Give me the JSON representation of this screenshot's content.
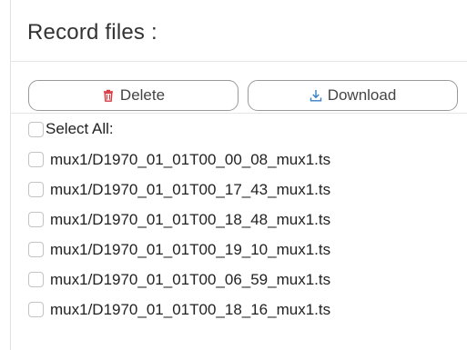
{
  "header": {
    "title": "Record files :"
  },
  "toolbar": {
    "delete_label": "Delete",
    "download_label": "Download",
    "delete_icon": "trash-icon",
    "download_icon": "download-icon",
    "delete_color": "#d9363e",
    "download_color": "#3a7fc4"
  },
  "list": {
    "select_all_label": "Select All:",
    "files": [
      "mux1/D1970_01_01T00_00_08_mux1.ts",
      "mux1/D1970_01_01T00_17_43_mux1.ts",
      "mux1/D1970_01_01T00_18_48_mux1.ts",
      "mux1/D1970_01_01T00_19_10_mux1.ts",
      "mux1/D1970_01_01T00_06_59_mux1.ts",
      "mux1/D1970_01_01T00_18_16_mux1.ts"
    ]
  }
}
